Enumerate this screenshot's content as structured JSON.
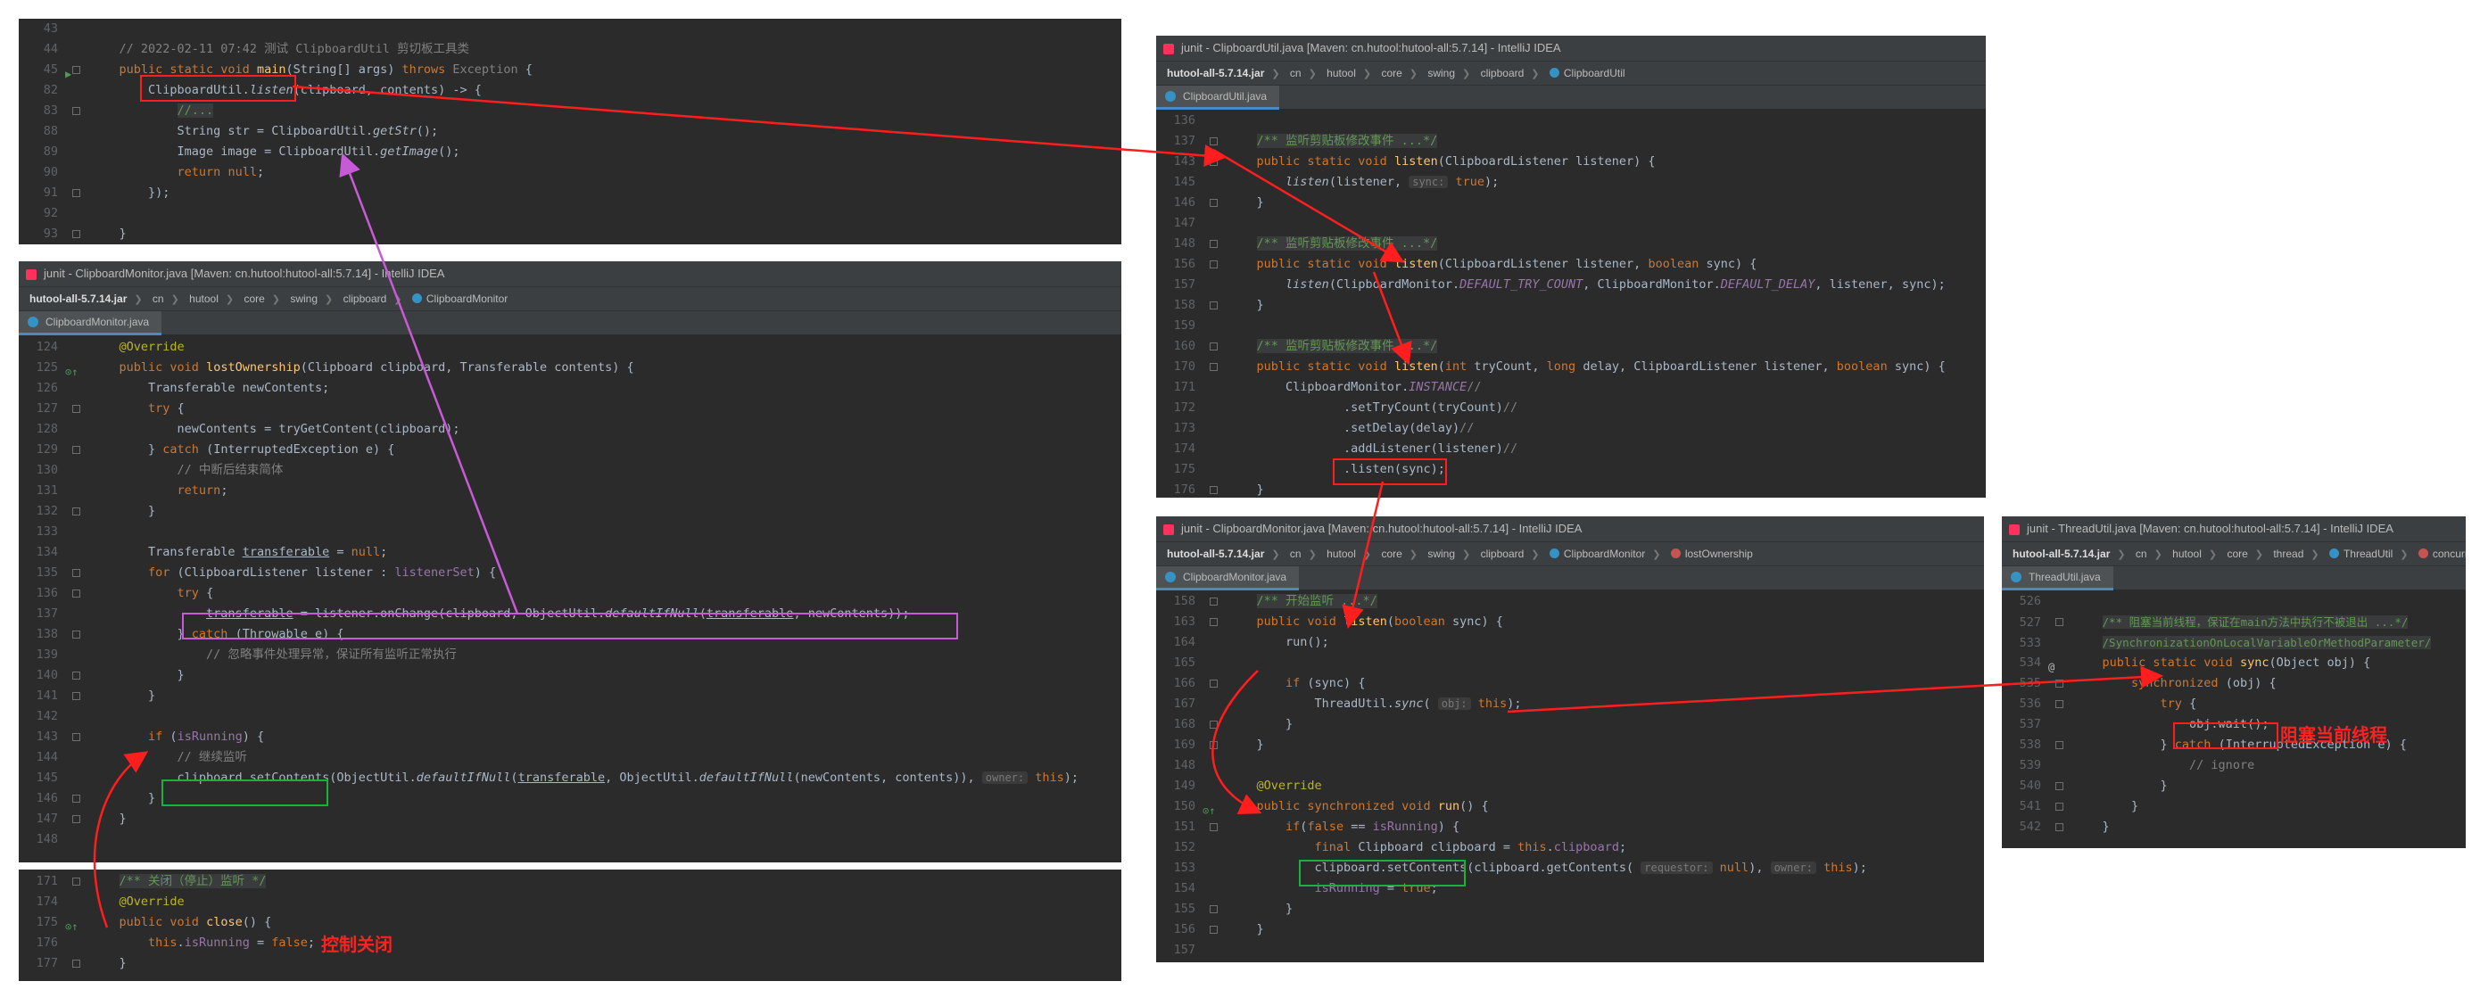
{
  "panel_main": {
    "lines": [
      {
        "n": "43",
        "html_key": "main_43"
      },
      {
        "n": "44",
        "html_key": "main_44"
      },
      {
        "n": "45",
        "html_key": "main_45"
      },
      {
        "n": "82",
        "html_key": "main_82"
      },
      {
        "n": "83",
        "html_key": "main_83"
      },
      {
        "n": "88",
        "html_key": "main_88"
      },
      {
        "n": "89",
        "html_key": "main_89"
      },
      {
        "n": "90",
        "html_key": "main_90"
      },
      {
        "n": "91",
        "html_key": "main_91"
      },
      {
        "n": "92",
        "html_key": "main_92"
      },
      {
        "n": "93",
        "html_key": "main_93"
      }
    ],
    "comment": "// 2022-02-11 07:42 测试 ClipboardUtil 剪切板工具类"
  },
  "panel_monitor": {
    "title": "junit - ClipboardMonitor.java [Maven: cn.hutool:hutool-all:5.7.14] - IntelliJ IDEA",
    "crumbs": [
      "hutool-all-5.7.14.jar",
      "cn",
      "hutool",
      "core",
      "swing",
      "clipboard",
      "ClipboardMonitor"
    ],
    "tab": "ClipboardMonitor.java",
    "comment_interrupt": "// 中断后结束简体",
    "comment_continue": "// 继续监听",
    "comment_ignore": "// 忽略事件处理异常，保证所有监听正常执行"
  },
  "panel_close": {
    "doc": "/** 关闭（停止）监听 */",
    "label": "控制关闭"
  },
  "panel_util": {
    "title": "junit - ClipboardUtil.java [Maven: cn.hutool:hutool-all:5.7.14] - IntelliJ IDEA",
    "crumbs": [
      "hutool-all-5.7.14.jar",
      "cn",
      "hutool",
      "core",
      "swing",
      "clipboard",
      "ClipboardUtil"
    ],
    "tab": "ClipboardUtil.java",
    "doc": "/** 监听剪贴板修改事件 ...*/"
  },
  "panel_listen": {
    "title": "junit - ClipboardMonitor.java [Maven: cn.hutool:hutool-all:5.7.14] - IntelliJ IDEA",
    "crumbs": [
      "hutool-all-5.7.14.jar",
      "cn",
      "hutool",
      "core",
      "swing",
      "clipboard",
      "ClipboardMonitor",
      "lostOwnership"
    ],
    "tab": "ClipboardMonitor.java",
    "doc": "/** 开始监听 ...*/"
  },
  "panel_thread": {
    "title": "junit - ThreadUtil.java [Maven: cn.hutool:hutool-all:5.7.14] - IntelliJ IDEA",
    "crumbs": [
      "hutool-all-5.7.14.jar",
      "cn",
      "hutool",
      "core",
      "thread",
      "ThreadUtil",
      "concurrencyTest"
    ],
    "tab": "ThreadUtil.java",
    "doc1": "/** 阻塞当前线程，保证在main方法中执行不被退出 ...*/",
    "doc2": "/SynchronizationOnLocalVariableOrMethodParameter/",
    "label": "阻塞当前线程"
  },
  "colors": {
    "red": "#ff1e1e",
    "green": "#19b33c",
    "purple": "#c75ad6",
    "editor_bg": "#2b2b2b"
  }
}
